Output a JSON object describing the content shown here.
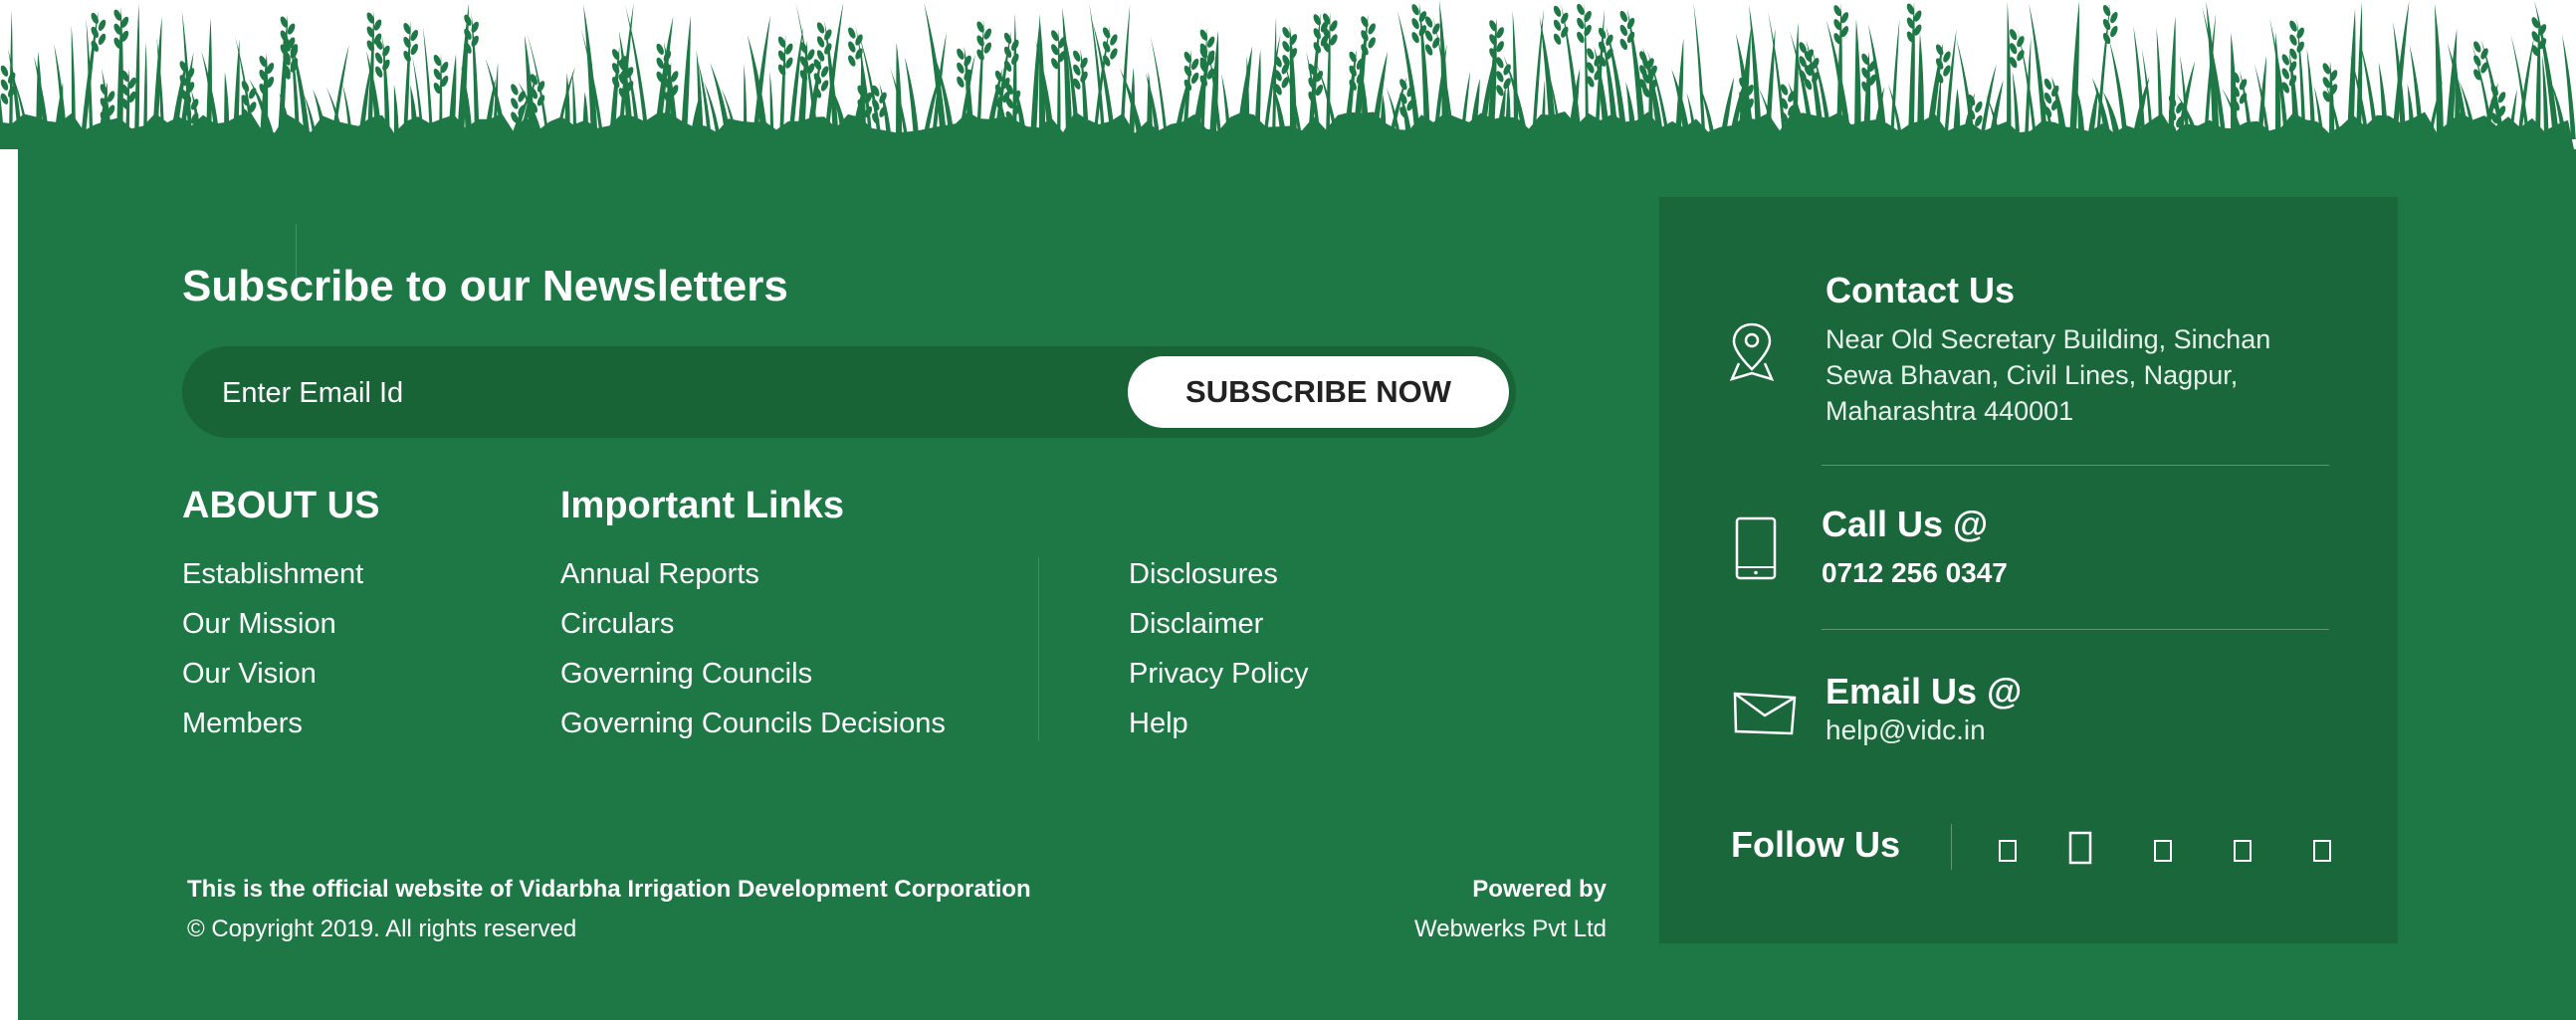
{
  "newsletter": {
    "title": "Subscribe to our Newsletters",
    "email_placeholder": "Enter Email Id",
    "email_value": "",
    "subscribe_label": "SUBSCRIBE NOW"
  },
  "about": {
    "title": "ABOUT US",
    "items": [
      "Establishment",
      "Our Mission",
      "Our Vision",
      "Members"
    ]
  },
  "important_links": {
    "title": "Important Links",
    "column1": [
      "Annual Reports",
      "Circulars",
      "Governing Councils",
      "Governing Councils Decisions"
    ],
    "column2": [
      "Disclosures",
      "Disclaimer",
      "Privacy Policy",
      "Help"
    ]
  },
  "footer": {
    "official_text": "This is the official website of Vidarbha Irrigation Development Corporation",
    "copyright": "© Copyright 2019. All rights reserved",
    "powered_by_label": "Powered by",
    "powered_by_company": "Webwerks Pvt Ltd"
  },
  "contact": {
    "title": "Contact Us",
    "address": "Near Old Secretary Building, Sinchan Sewa Bhavan, Civil Lines, Nagpur, Maharashtra 440001",
    "call_title": "Call Us @",
    "phone": "0712 256 0347",
    "email_title": "Email Us @",
    "email": "help@vidc.in",
    "icons": [
      "location-pin-icon",
      "mobile-phone-icon",
      "envelope-icon"
    ]
  },
  "follow": {
    "title": "Follow Us",
    "socials": [
      "social-icon-1",
      "social-icon-2",
      "social-icon-3",
      "social-icon-4",
      "social-icon-5"
    ]
  },
  "colors": {
    "footer_green": "#1e7845",
    "panel_green": "#1a673b",
    "input_green": "#186437",
    "button_white": "#ffffff",
    "button_text": "#222222"
  }
}
